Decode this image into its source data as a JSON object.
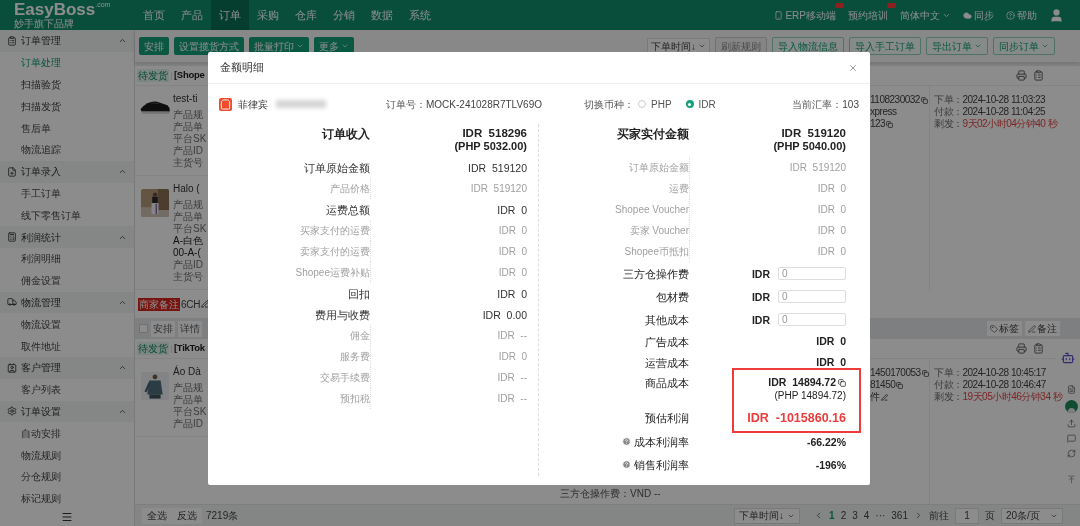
{
  "nav": {
    "logo": "EasyBoss",
    "logo_domain": ".com",
    "tagline": "妙手旗下品牌",
    "items": [
      {
        "label": "首页",
        "selected": false
      },
      {
        "label": "产品",
        "selected": false
      },
      {
        "label": "订单",
        "selected": true
      },
      {
        "label": "采购",
        "selected": false
      },
      {
        "label": "仓库",
        "selected": false
      },
      {
        "label": "分销",
        "selected": false
      },
      {
        "label": "数据",
        "selected": false
      },
      {
        "label": "系统",
        "selected": false
      }
    ],
    "tools": [
      {
        "label": "ERP移动端",
        "kind": "mobile",
        "badge": true
      },
      {
        "label": "预约培训",
        "kind": "training",
        "badge": true
      },
      {
        "label": "简体中文",
        "kind": "language",
        "badge": false
      },
      {
        "label": "同步",
        "kind": "sync",
        "badge": false
      },
      {
        "label": "帮助",
        "kind": "help",
        "badge": false
      }
    ]
  },
  "sidebar": {
    "groups": [
      {
        "label": "订单管理",
        "expanded": true,
        "items": [
          {
            "label": "订单处理",
            "selected": true
          },
          {
            "label": "扫描验货",
            "selected": false
          },
          {
            "label": "扫描发货",
            "selected": false
          },
          {
            "label": "售后单",
            "selected": false
          },
          {
            "label": "物流追踪",
            "selected": false
          }
        ]
      },
      {
        "label": "订单录入",
        "expanded": true,
        "items": [
          {
            "label": "手工订单",
            "selected": false
          },
          {
            "label": "线下零售订单",
            "selected": false
          }
        ]
      },
      {
        "label": "利润统计",
        "expanded": true,
        "items": [
          {
            "label": "利润明细",
            "selected": false
          },
          {
            "label": "佣金设置",
            "selected": false
          }
        ]
      },
      {
        "label": "物流管理",
        "expanded": true,
        "items": [
          {
            "label": "物流设置",
            "selected": false
          },
          {
            "label": "取件地址",
            "selected": false
          }
        ]
      },
      {
        "label": "客户管理",
        "expanded": true,
        "items": [
          {
            "label": "客户列表",
            "selected": false
          }
        ]
      },
      {
        "label": "订单设置",
        "expanded": true,
        "items": [
          {
            "label": "自动安排",
            "selected": false
          },
          {
            "label": "物流规则",
            "selected": false
          },
          {
            "label": "分仓规则",
            "selected": false
          },
          {
            "label": "标记规则",
            "selected": false
          }
        ]
      }
    ]
  },
  "toolbar": {
    "left": [
      {
        "label": "安排",
        "kind": "plain"
      },
      {
        "label": "设置揽货方式",
        "kind": "plain"
      },
      {
        "label": "批量打印",
        "kind": "dropdown"
      },
      {
        "label": "更多",
        "kind": "dropdown"
      }
    ],
    "sort": "下单时间↓",
    "right": [
      {
        "label": "刷新规则",
        "kind": "disabled"
      },
      {
        "label": "导入物流信息",
        "kind": "plain"
      },
      {
        "label": "导入手工订单",
        "kind": "plain"
      },
      {
        "label": "导出订单",
        "kind": "dropdown"
      },
      {
        "label": "同步订单",
        "kind": "dropdown"
      }
    ]
  },
  "orders": [
    {
      "status": "待发货",
      "platform": "[Shope",
      "products": [
        {
          "title": "test-ti",
          "details": [
            {
              "text": "产品规",
              "kind": "label"
            },
            {
              "text": "产品单",
              "kind": "label"
            },
            {
              "text": "平台SK",
              "kind": "label"
            },
            {
              "text": "产品ID",
              "kind": "label"
            },
            {
              "text": "主货号",
              "kind": "label"
            }
          ]
        },
        {
          "title": "Halo (",
          "details": [
            {
              "text": "产品规",
              "kind": "label"
            },
            {
              "text": "产品单",
              "kind": "label"
            },
            {
              "text": "平台SK",
              "kind": "label"
            },
            {
              "text": "A-白色",
              "kind": "value"
            },
            {
              "text": "00-A-(",
              "kind": "value"
            },
            {
              "text": "产品ID",
              "kind": "label"
            },
            {
              "text": "主货号",
              "kind": "label"
            }
          ]
        }
      ],
      "ids": [
        {
          "text": "1108230032",
          "kind": "copy"
        },
        {
          "text": "xpress",
          "kind": "plain"
        },
        {
          "text": "123",
          "kind": "copy"
        }
      ],
      "times": [
        {
          "label": "下单：",
          "value": "2024-10-28 11:03:23",
          "urgent": false
        },
        {
          "label": "付款：",
          "value": "2024-10-28 11:04:25",
          "urgent": false
        },
        {
          "label": "剩发：",
          "value": "9天02小时04分钟40 秒",
          "urgent": true
        }
      ],
      "note": {
        "tag": "商家备注",
        "text": "6CH"
      }
    },
    {
      "status": "待发货",
      "platform": "[TikTok",
      "checked": false,
      "actions": [
        "安排",
        "详情"
      ],
      "tags": [
        {
          "label": "标签",
          "kind": "tag"
        },
        {
          "label": "备注",
          "kind": "note"
        }
      ],
      "products": [
        {
          "title": "Áo Dà",
          "details": [
            {
              "text": "产品规",
              "kind": "label"
            },
            {
              "text": "产品单",
              "kind": "label"
            },
            {
              "text": "平台SK",
              "kind": "label"
            },
            {
              "text": "产品ID",
              "kind": "label"
            }
          ]
        }
      ],
      "ids": [
        {
          "text": "1450170053",
          "kind": "copy"
        },
        {
          "text": "81450",
          "kind": "copy"
        },
        {
          "text": "件",
          "kind": "edit"
        }
      ],
      "times": [
        {
          "label": "下单：",
          "value": "2024-10-28 10:45:17",
          "urgent": false
        },
        {
          "label": "付款：",
          "value": "2024-10-28 10:46:47",
          "urgent": false
        },
        {
          "label": "剩发：",
          "value": "19天05小时46分钟34 秒",
          "urgent": true
        }
      ],
      "extra": "三方仓操作费：VND --"
    }
  ],
  "footer": {
    "select_all": "全选",
    "invert": "反选",
    "count": "7219条",
    "sort": "下单时间↓",
    "pages": [
      {
        "label": "1",
        "selected": true
      },
      {
        "label": "2",
        "selected": false
      },
      {
        "label": "3",
        "selected": false
      },
      {
        "label": "4",
        "selected": false
      },
      {
        "label": "···",
        "selected": false
      },
      {
        "label": "361",
        "selected": false
      }
    ],
    "goto_label": "前往",
    "goto_value": "1",
    "page_unit": "页",
    "page_size": "20条/页"
  },
  "modal": {
    "title": "金额明细",
    "region": "菲律宾",
    "order_no_label": "订单号：",
    "order_no": "MOCK-241028R7TLV69O",
    "currency_label": "切换币种：",
    "currencies": [
      {
        "label": "PHP",
        "selected": false
      },
      {
        "label": "IDR",
        "selected": true
      }
    ],
    "rate_label": "当前汇率：",
    "rate": "103",
    "income": [
      {
        "kind": "total",
        "label": "订单收入",
        "value": "IDR  518296",
        "sub_value": "(PHP 5032.00)"
      },
      {
        "kind": "main",
        "label": "订单原始金额",
        "value": "IDR  519120"
      },
      {
        "kind": "sub",
        "label": "产品价格",
        "value": "IDR  519120"
      },
      {
        "kind": "main",
        "label": "运费总额",
        "value": "IDR  0"
      },
      {
        "kind": "sub",
        "label": "买家支付的运费",
        "value": "IDR  0"
      },
      {
        "kind": "sub",
        "label": "卖家支付的运费",
        "value": "IDR  0"
      },
      {
        "kind": "sub",
        "label": "Shopee运费补贴",
        "value": "IDR  0"
      },
      {
        "kind": "main",
        "label": "回扣",
        "value": "IDR  0"
      },
      {
        "kind": "main",
        "label": "费用与收费",
        "value": "IDR  0.00"
      },
      {
        "kind": "sub",
        "label": "佣金",
        "value": "IDR  --"
      },
      {
        "kind": "sub",
        "label": "服务费",
        "value": "IDR  0"
      },
      {
        "kind": "sub",
        "label": "交易手续费",
        "value": "IDR  --"
      },
      {
        "kind": "sub",
        "label": "预扣税",
        "value": "IDR  --"
      }
    ],
    "costs": [
      {
        "kind": "total",
        "label": "买家实付金额",
        "value": "IDR  519120",
        "sub_value": "(PHP 5040.00)",
        "highlighted": false
      },
      {
        "kind": "sub",
        "label": "订单原始金额",
        "value": "IDR  519120",
        "highlighted": false
      },
      {
        "kind": "sub",
        "label": "运费",
        "value": "IDR  0",
        "highlighted": false
      },
      {
        "kind": "sub",
        "label": "Shopee Voucher",
        "value": "IDR  0",
        "highlighted": false
      },
      {
        "kind": "sub",
        "label": "卖家 Voucher",
        "value": "IDR  0",
        "highlighted": false
      },
      {
        "kind": "sub",
        "label": "Shopee币抵扣",
        "value": "IDR  0",
        "highlighted": false
      },
      {
        "kind": "input",
        "label": "三方仓操作费",
        "currency": "IDR",
        "placeholder": "0",
        "highlighted": false
      },
      {
        "kind": "input",
        "label": "包材费",
        "currency": "IDR",
        "placeholder": "0",
        "highlighted": false
      },
      {
        "kind": "input",
        "label": "其他成本",
        "currency": "IDR",
        "placeholder": "0",
        "highlighted": false
      },
      {
        "kind": "cost",
        "label": "广告成本",
        "value": "IDR  0",
        "highlighted": false
      },
      {
        "kind": "cost",
        "label": "运营成本",
        "value": "IDR  0",
        "highlighted": false
      },
      {
        "kind": "cost",
        "label": "商品成本",
        "value": "IDR  14894.72",
        "sub_value": "(PHP 14894.72)",
        "copyable": true,
        "highlighted": true
      },
      {
        "kind": "profit",
        "label": "预估利润",
        "value": "IDR  -1015860.16",
        "highlighted": true
      },
      {
        "kind": "ratio",
        "label": "成本利润率",
        "value": "-66.22%",
        "highlighted": false
      },
      {
        "kind": "ratio",
        "label": "销售利润率",
        "value": "-196%",
        "highlighted": false
      }
    ]
  }
}
